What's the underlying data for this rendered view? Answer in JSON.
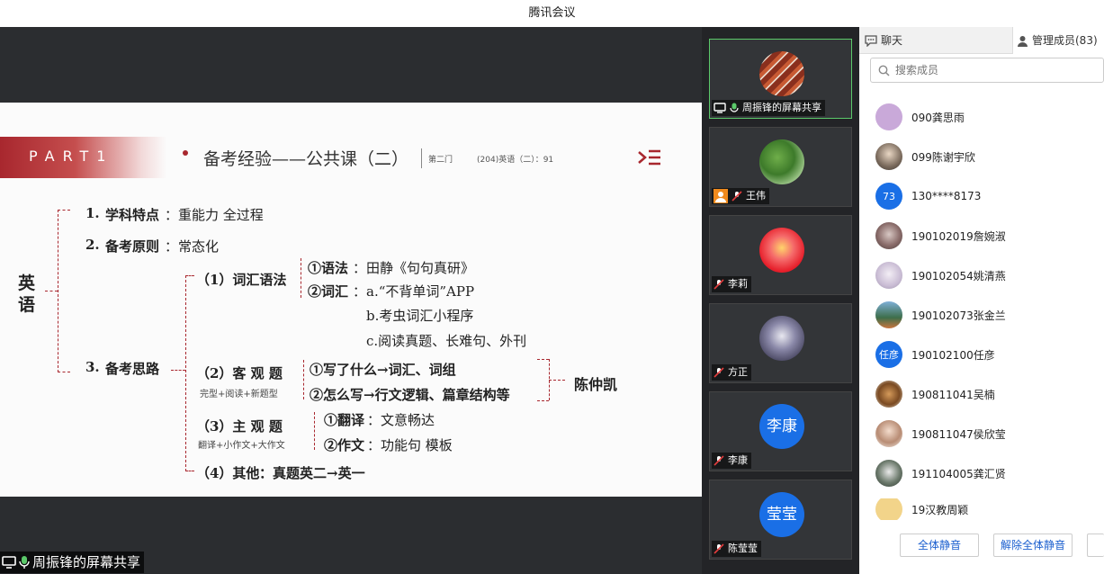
{
  "window": {
    "title": "腾讯会议"
  },
  "slide": {
    "part": "PART1",
    "title": "备考经验——公共课（二）",
    "note1": "第二门",
    "note2": "(204)英语（二）：91",
    "subject_l1": "英",
    "subject_l2": "语",
    "item1_num": "1.",
    "item1_label": "学科特点",
    "item1_text": "：重能力 全过程",
    "item2_num": "2.",
    "item2_label": "备考原则",
    "item2_text": "：常态化",
    "item3_num": "3.",
    "item3_label": "备考思路",
    "s1_label": "（1）词汇语法",
    "s1_g_label": "①语法",
    "s1_g_text": "：田静《句句真研》",
    "s1_v_label": "②词汇",
    "s1_v_a": "：a.“不背单词”APP",
    "s1_v_b": "b.考虫词汇小程序",
    "s1_v_c": "c.阅读真题、长难句、外刊",
    "s2_label": "（2）客 观 题",
    "s2_sub": "完型+阅读+新题型",
    "s2_a": "①写了什么→词汇、词组",
    "s2_b": "②怎么写→行文逻辑、篇章结构等",
    "s2_teacher": "陈仲凯",
    "s3_label": "（3）主 观 题",
    "s3_sub": "翻译+小作文+大作文",
    "s3_a_label": "①翻译",
    "s3_a_text": "：文意畅达",
    "s3_b_label": "②作文",
    "s3_b_text": "：功能句 模板",
    "s4_label": "（4）其他",
    "s4_text": "：真题英二→英一"
  },
  "gallery": {
    "tiles": [
      {
        "name": "周振锋的屏幕共享",
        "active": true
      },
      {
        "name": "王伟"
      },
      {
        "name": "李莉"
      },
      {
        "name": "方正"
      },
      {
        "name": "李康",
        "avatar_text": "李康"
      },
      {
        "name": "陈莹莹",
        "avatar_text": "莹莹"
      }
    ]
  },
  "share_tag": "周振锋的屏幕共享",
  "panel": {
    "tab_chat": "聊天",
    "tab_members": "管理成员(83)",
    "search_placeholder": "搜索成员",
    "members": [
      {
        "name": "090龚思雨",
        "avatar_text": ""
      },
      {
        "name": "099陈谢宇欣",
        "avatar_text": ""
      },
      {
        "name": "130****8173",
        "avatar_text": "73"
      },
      {
        "name": "190102019詹婉淑",
        "avatar_text": ""
      },
      {
        "name": "190102054姚清燕",
        "avatar_text": ""
      },
      {
        "name": "190102073张金兰",
        "avatar_text": ""
      },
      {
        "name": "190102100任彦",
        "avatar_text": "任彦"
      },
      {
        "name": "190811041吴楠",
        "avatar_text": ""
      },
      {
        "name": "190811047侯欣莹",
        "avatar_text": ""
      },
      {
        "name": "191104005龚汇贤",
        "avatar_text": ""
      },
      {
        "name": "19汉教周颖",
        "avatar_text": ""
      }
    ],
    "btn_mute_all": "全体静音",
    "btn_unmute_all": "解除全体静音"
  },
  "colors": {
    "accent_red": "#a8272e",
    "blue": "#1a6fe6",
    "active_green": "#5bc96a"
  }
}
